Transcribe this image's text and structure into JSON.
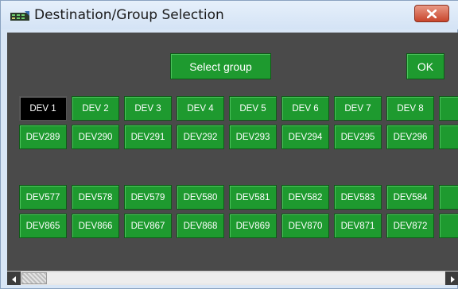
{
  "window": {
    "title": "Destination/Group Selection",
    "icon": "app-logo-icon",
    "close_icon": "close-icon",
    "close_color": "#c8452c"
  },
  "toolbar": {
    "select_group_label": "Select group",
    "ok_label": "OK"
  },
  "accent": "#1e9a2f",
  "selected_color": "#000000",
  "rows": [
    [
      "DEV  1",
      "DEV  2",
      "DEV  3",
      "DEV  4",
      "DEV  5",
      "DEV  6",
      "DEV  7",
      "DEV  8"
    ],
    [
      "DEV289",
      "DEV290",
      "DEV291",
      "DEV292",
      "DEV293",
      "DEV294",
      "DEV295",
      "DEV296"
    ],
    [
      "DEV577",
      "DEV578",
      "DEV579",
      "DEV580",
      "DEV581",
      "DEV582",
      "DEV583",
      "DEV584"
    ],
    [
      "DEV865",
      "DEV866",
      "DEV867",
      "DEV868",
      "DEV869",
      "DEV870",
      "DEV871",
      "DEV872"
    ]
  ],
  "selected": "DEV  1",
  "scrollbar": {
    "left_icon": "arrow-left-icon",
    "right_icon": "arrow-right-icon"
  }
}
